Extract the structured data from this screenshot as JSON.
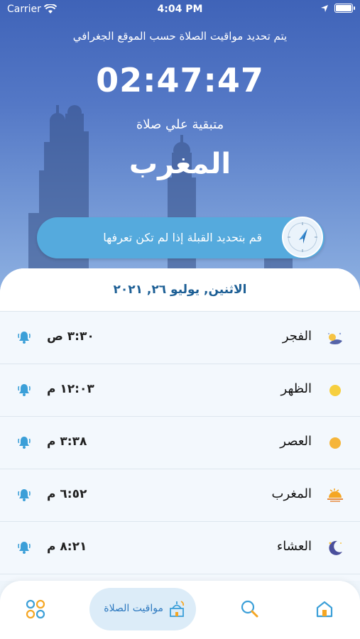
{
  "status_bar": {
    "carrier": "Carrier",
    "time": "4:04 PM"
  },
  "hero": {
    "info_text": "يتم تحديد مواقيت الصلاة حسب الموقع الجغرافي",
    "countdown": "02:47:47",
    "remaining_label": "متبقية علي صلاة",
    "next_prayer": "المغرب"
  },
  "qibla": {
    "label": "قم بتحديد القبلة إذا لم تكن تعرفها",
    "icon": "compass-icon"
  },
  "date": "الاثنين, يوليو ٢٦, ٢٠٢١",
  "prayers": [
    {
      "name": "الفجر",
      "time": "٣:٣٠ ص",
      "icon": "dawn-icon"
    },
    {
      "name": "الظهر",
      "time": "١٢:٠٣ م",
      "icon": "sun-icon"
    },
    {
      "name": "العصر",
      "time": "٣:٣٨ م",
      "icon": "sun-icon"
    },
    {
      "name": "المغرب",
      "time": "٦:٥٢ م",
      "icon": "sunset-icon"
    },
    {
      "name": "العشاء",
      "time": "٨:٢١ م",
      "icon": "moon-icon"
    }
  ],
  "tab_bar": {
    "prayer_times_label": "مواقيت الصلاة",
    "items": [
      "apps-grid-icon",
      "mosque-icon",
      "search-icon",
      "home-icon"
    ]
  },
  "colors": {
    "accent": "#2c78bf",
    "bell": "#3b9fd8",
    "sun": "#f6c343",
    "pill": "#55aadd"
  }
}
